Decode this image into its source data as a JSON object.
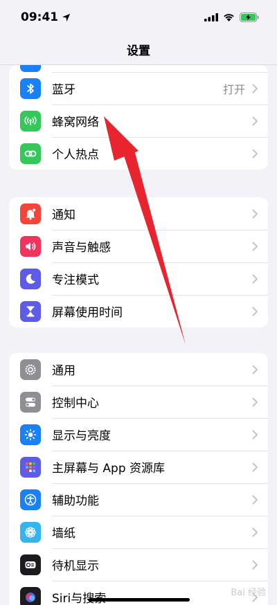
{
  "status_bar": {
    "time": "09:41"
  },
  "nav": {
    "title": "设置"
  },
  "groups": [
    {
      "rows": [
        {
          "label": "蓝牙",
          "value": "打开",
          "icon": "bluetooth-icon",
          "color": "#1a80f6"
        },
        {
          "label": "蜂窝网络",
          "value": "",
          "icon": "cellular-icon",
          "color": "#34c759"
        },
        {
          "label": "个人热点",
          "value": "",
          "icon": "hotspot-icon",
          "color": "#34c759"
        }
      ]
    },
    {
      "rows": [
        {
          "label": "通知",
          "icon": "notification-icon",
          "color": "#f5453a"
        },
        {
          "label": "声音与触感",
          "icon": "sound-icon",
          "color": "#f2335e"
        },
        {
          "label": "专注模式",
          "icon": "focus-moon-icon",
          "color": "#5e5ce6"
        },
        {
          "label": "屏幕使用时间",
          "icon": "hourglass-icon",
          "color": "#5e5ce6"
        }
      ]
    },
    {
      "rows": [
        {
          "label": "通用",
          "icon": "gear-icon",
          "color": "#8e8e93"
        },
        {
          "label": "控制中心",
          "icon": "toggles-icon",
          "color": "#8e8e93"
        },
        {
          "label": "显示与亮度",
          "icon": "sun-icon",
          "color": "#1a80f6"
        },
        {
          "label": "主屏幕与 App 资源库",
          "icon": "app-grid-icon",
          "color": "#5e5ce6"
        },
        {
          "label": "辅助功能",
          "icon": "accessibility-icon",
          "color": "#1a80f6"
        },
        {
          "label": "墙纸",
          "icon": "flower-icon",
          "color": "#35b5f0"
        },
        {
          "label": "待机显示",
          "icon": "standby-icon",
          "color": "#1c1c1e"
        },
        {
          "label": "Siri与搜索",
          "icon": "siri-icon",
          "color": "#1c1c1e"
        }
      ]
    }
  ],
  "annotation": {
    "arrow_color": "#e8242e"
  },
  "watermark": {
    "text": "Bai 经验"
  }
}
